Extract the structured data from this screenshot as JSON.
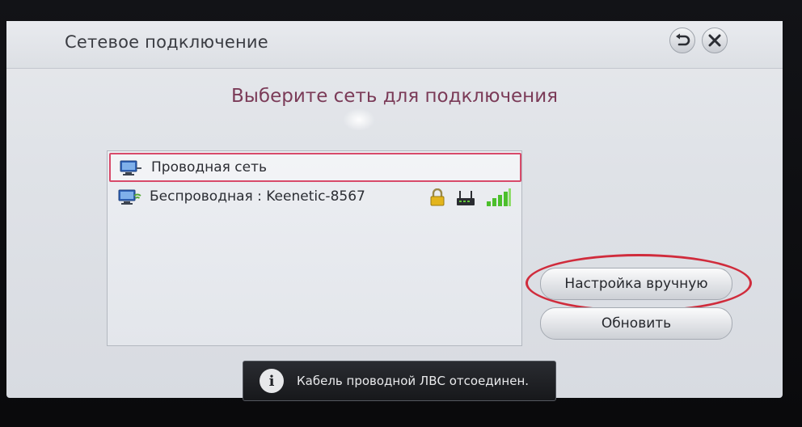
{
  "dialog": {
    "title": "Сетевое подключение",
    "prompt": "Выберите сеть для подключения"
  },
  "networks": [
    {
      "label": "Проводная сеть",
      "icon": "wired-network-icon",
      "selected": true
    },
    {
      "label": "Беспроводная : Keenetic-8567",
      "icon": "wireless-network-icon",
      "status_icons": [
        "lock-icon",
        "router-icon",
        "signal-strength-icon"
      ]
    }
  ],
  "buttons": {
    "manual": "Настройка вручную",
    "refresh": "Обновить"
  },
  "notification": {
    "icon_glyph": "i",
    "text": "Кабель проводной ЛВС отсоединен."
  },
  "colors": {
    "selection": "#d84a6a",
    "prompt": "#7b3b58",
    "highlight_ring": "#d02c3c",
    "signal": "#4cbf2c",
    "lock": "#e3b51d"
  }
}
